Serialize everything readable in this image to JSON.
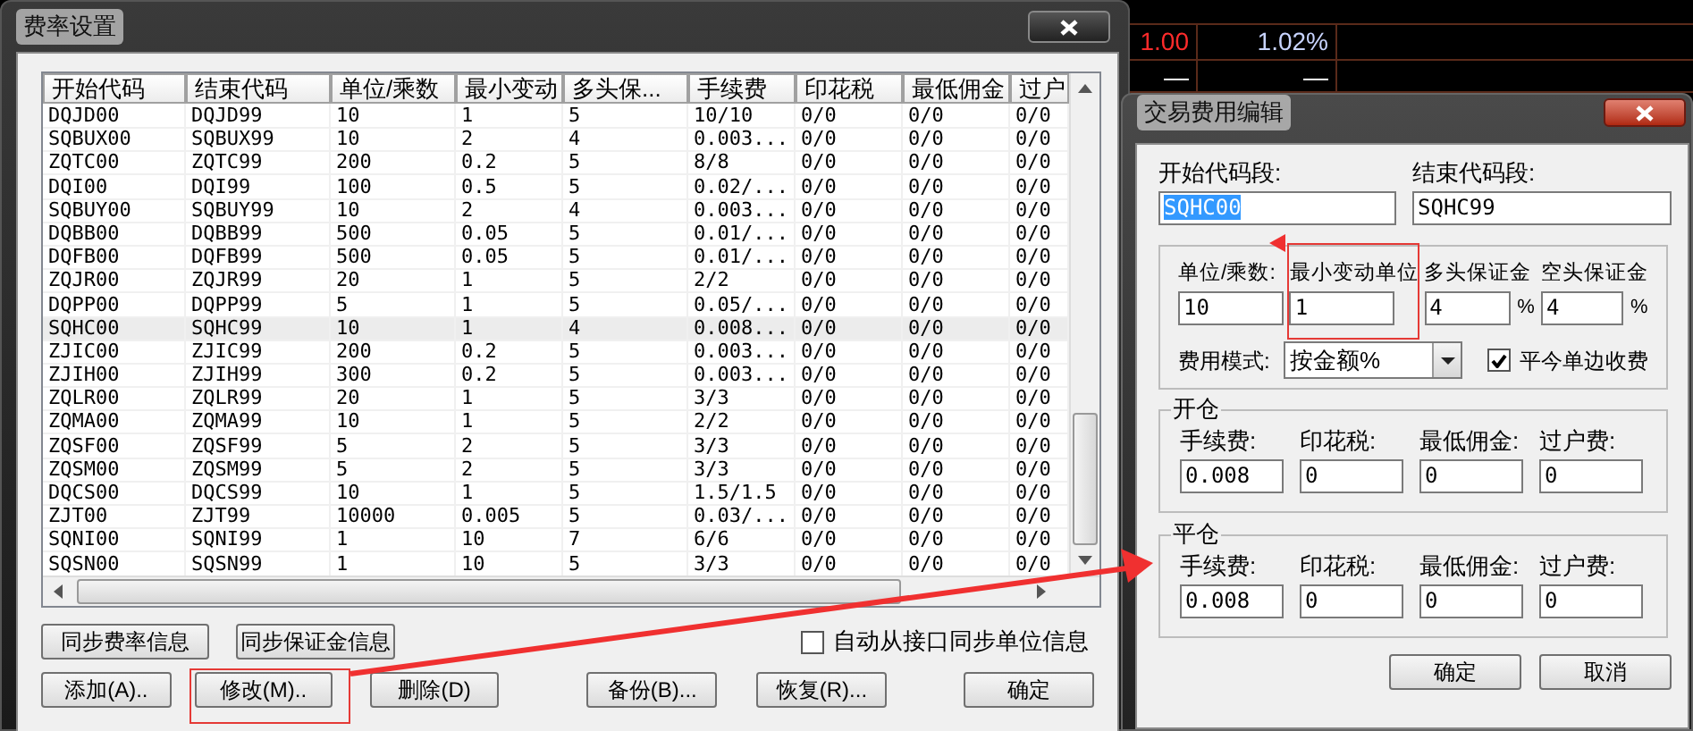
{
  "market_cells": [
    {
      "text": "1.00",
      "color": "#ff2b2b"
    },
    {
      "text": "1.02%",
      "color": "#c8d4ff"
    },
    {
      "text": "—",
      "color": "#ffffff"
    },
    {
      "text": "—",
      "color": "#ffffff"
    }
  ],
  "fee_settings": {
    "title": "费率设置",
    "table": {
      "columns": [
        "开始代码",
        "结束代码",
        "单位/乘数",
        "最小变动",
        "多头保...",
        "手续费",
        "印花税",
        "最低佣金",
        "过户"
      ],
      "rows": [
        {
          "cells": [
            "DQJD00",
            "DQJD99",
            "10",
            "1",
            "5",
            "10/10",
            "0/0",
            "0/0",
            "0/0"
          ],
          "selected": false
        },
        {
          "cells": [
            "SQBUX00",
            "SQBUX99",
            "10",
            "2",
            "4",
            "0.003...",
            "0/0",
            "0/0",
            "0/0"
          ],
          "selected": false
        },
        {
          "cells": [
            "ZQTC00",
            "ZQTC99",
            "200",
            "0.2",
            "5",
            "8/8",
            "0/0",
            "0/0",
            "0/0"
          ],
          "selected": false
        },
        {
          "cells": [
            "DQI00",
            "DQI99",
            "100",
            "0.5",
            "5",
            "0.02/...",
            "0/0",
            "0/0",
            "0/0"
          ],
          "selected": false
        },
        {
          "cells": [
            "SQBUY00",
            "SQBUY99",
            "10",
            "2",
            "4",
            "0.003...",
            "0/0",
            "0/0",
            "0/0"
          ],
          "selected": false
        },
        {
          "cells": [
            "DQBB00",
            "DQBB99",
            "500",
            "0.05",
            "5",
            "0.01/...",
            "0/0",
            "0/0",
            "0/0"
          ],
          "selected": false
        },
        {
          "cells": [
            "DQFB00",
            "DQFB99",
            "500",
            "0.05",
            "5",
            "0.01/...",
            "0/0",
            "0/0",
            "0/0"
          ],
          "selected": false
        },
        {
          "cells": [
            "ZQJR00",
            "ZQJR99",
            "20",
            "1",
            "5",
            "2/2",
            "0/0",
            "0/0",
            "0/0"
          ],
          "selected": false
        },
        {
          "cells": [
            "DQPP00",
            "DQPP99",
            "5",
            "1",
            "5",
            "0.05/...",
            "0/0",
            "0/0",
            "0/0"
          ],
          "selected": false
        },
        {
          "cells": [
            "SQHC00",
            "SQHC99",
            "10",
            "1",
            "4",
            "0.008...",
            "0/0",
            "0/0",
            "0/0"
          ],
          "selected": true
        },
        {
          "cells": [
            "ZJIC00",
            "ZJIC99",
            "200",
            "0.2",
            "5",
            "0.003...",
            "0/0",
            "0/0",
            "0/0"
          ],
          "selected": false
        },
        {
          "cells": [
            "ZJIH00",
            "ZJIH99",
            "300",
            "0.2",
            "5",
            "0.003...",
            "0/0",
            "0/0",
            "0/0"
          ],
          "selected": false
        },
        {
          "cells": [
            "ZQLR00",
            "ZQLR99",
            "20",
            "1",
            "5",
            "3/3",
            "0/0",
            "0/0",
            "0/0"
          ],
          "selected": false
        },
        {
          "cells": [
            "ZQMA00",
            "ZQMA99",
            "10",
            "1",
            "5",
            "2/2",
            "0/0",
            "0/0",
            "0/0"
          ],
          "selected": false
        },
        {
          "cells": [
            "ZQSF00",
            "ZQSF99",
            "5",
            "2",
            "5",
            "3/3",
            "0/0",
            "0/0",
            "0/0"
          ],
          "selected": false
        },
        {
          "cells": [
            "ZQSM00",
            "ZQSM99",
            "5",
            "2",
            "5",
            "3/3",
            "0/0",
            "0/0",
            "0/0"
          ],
          "selected": false
        },
        {
          "cells": [
            "DQCS00",
            "DQCS99",
            "10",
            "1",
            "5",
            "1.5/1.5",
            "0/0",
            "0/0",
            "0/0"
          ],
          "selected": false
        },
        {
          "cells": [
            "ZJT00",
            "ZJT99",
            "10000",
            "0.005",
            "5",
            "0.03/...",
            "0/0",
            "0/0",
            "0/0"
          ],
          "selected": false
        },
        {
          "cells": [
            "SQNI00",
            "SQNI99",
            "1",
            "10",
            "7",
            "6/6",
            "0/0",
            "0/0",
            "0/0"
          ],
          "selected": false
        },
        {
          "cells": [
            "SQSN00",
            "SQSN99",
            "1",
            "10",
            "5",
            "3/3",
            "0/0",
            "0/0",
            "0/0"
          ],
          "selected": false
        }
      ]
    },
    "sync_buttons": [
      "同步费率信息",
      "同步保证金信息"
    ],
    "auto_sync": {
      "label": "自动从接口同步单位信息",
      "checked": false
    },
    "buttons": [
      "添加(A)..",
      "修改(M)..",
      "删除(D)",
      "备份(B)...",
      "恢复(R)...",
      "确定"
    ]
  },
  "fee_edit": {
    "title": "交易费用编辑",
    "codes": [
      {
        "label": "开始代码段:",
        "value": "SQHC00",
        "selected": true
      },
      {
        "label": "结束代码段:",
        "value": "SQHC99",
        "selected": false
      }
    ],
    "units": [
      {
        "label": "单位/乘数:",
        "value": "10"
      },
      {
        "label": "最小变动单位",
        "value": "1"
      },
      {
        "label": "多头保证金",
        "value": "4",
        "suffix": "%"
      },
      {
        "label": "空头保证金",
        "value": "4",
        "suffix": "%"
      }
    ],
    "fee_mode": {
      "label": "费用模式:",
      "value": "按金额%"
    },
    "single_side": {
      "label": "平今单边收费",
      "checked": true
    },
    "sections": [
      {
        "title": "开仓",
        "fields": [
          {
            "label": "手续费:",
            "value": "0.008"
          },
          {
            "label": "印花税:",
            "value": "0"
          },
          {
            "label": "最低佣金:",
            "value": "0"
          },
          {
            "label": "过户费:",
            "value": "0"
          }
        ]
      },
      {
        "title": "平仓",
        "fields": [
          {
            "label": "手续费:",
            "value": "0.008"
          },
          {
            "label": "印花税:",
            "value": "0"
          },
          {
            "label": "最低佣金:",
            "value": "0"
          },
          {
            "label": "过户费:",
            "value": "0"
          }
        ]
      }
    ],
    "buttons": [
      "确定",
      "取消"
    ]
  }
}
